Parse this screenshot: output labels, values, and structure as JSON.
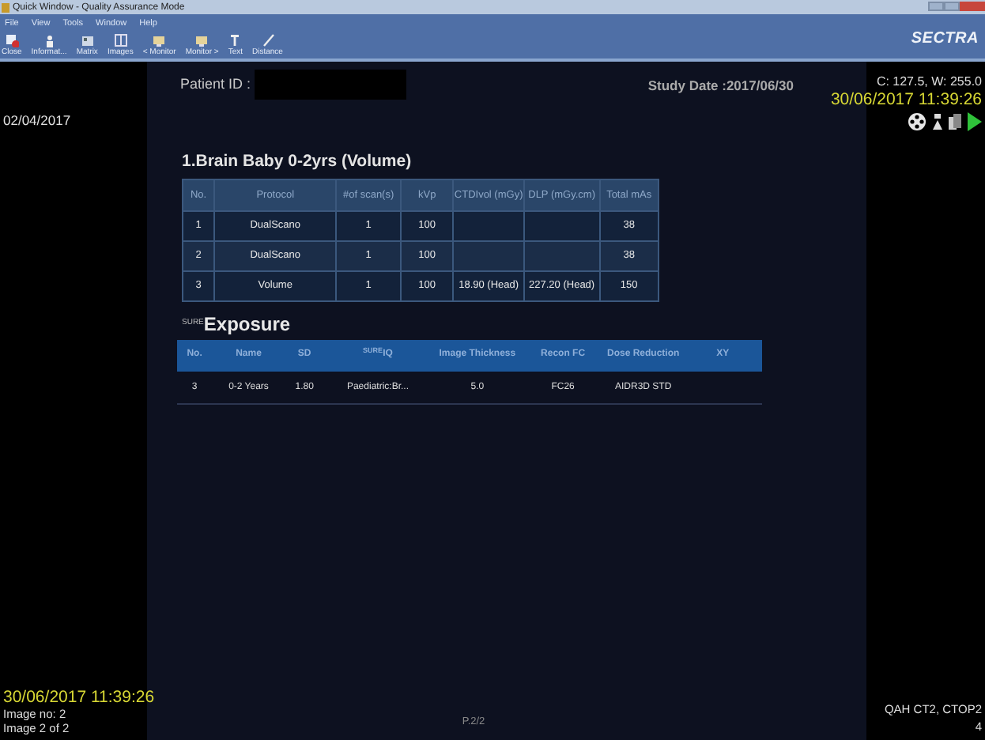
{
  "window": {
    "title": "Quick Window - Quality Assurance Mode"
  },
  "menu": [
    "File",
    "View",
    "Tools",
    "Window",
    "Help"
  ],
  "toolbar": [
    {
      "label": "Close",
      "kind": "close"
    },
    {
      "label": "Informat...",
      "kind": "info"
    },
    {
      "label": "Matrix",
      "kind": "matrix"
    },
    {
      "label": "Images",
      "kind": "images"
    },
    {
      "label": "< Monitor",
      "kind": "monitor"
    },
    {
      "label": "Monitor >",
      "kind": "monitor"
    },
    {
      "label": "Text",
      "kind": "text"
    },
    {
      "label": "Distance",
      "kind": "distance"
    }
  ],
  "brand": "SECTRA",
  "left_date": "02/04/2017",
  "patient_id_label": "Patient ID :",
  "study_date": "Study Date :2017/06/30",
  "window_level": "C: 127.5, W: 255.0",
  "top_timestamp": "30/06/2017 11:39:26",
  "section_title": "1.Brain Baby 0-2yrs  (Volume)",
  "scan_table": {
    "columns": [
      "No.",
      "Protocol",
      "#of scan(s)",
      "kVp",
      "CTDIvol (mGy)",
      "DLP (mGy.cm)",
      "Total mAs"
    ],
    "rows": [
      [
        "1",
        "DualScano",
        "1",
        "100",
        "",
        "",
        "38"
      ],
      [
        "2",
        "DualScano",
        "1",
        "100",
        "",
        "",
        "38"
      ],
      [
        "3",
        "Volume",
        "1",
        "100",
        "18.90 (Head)",
        "227.20 (Head)",
        "150"
      ]
    ]
  },
  "exposure_title": {
    "prefix": "SURE",
    "text": "Exposure"
  },
  "exposure_table": {
    "columns": [
      "No.",
      "Name",
      "SD",
      "$^{SURE}$IQ",
      "Image Thickness",
      "Recon FC",
      "Dose Reduction",
      "XY"
    ],
    "rows": [
      [
        "3",
        "0-2 Years",
        "1.80",
        "Paediatric:Br...",
        "5.0",
        "FC26",
        "AIDR3D STD",
        ""
      ]
    ]
  },
  "bottom_timestamp": "30/06/2017 11:39:26",
  "image_no": "Image no: 2",
  "image_of": "Image 2 of 2",
  "page": "P.2/2",
  "station": "QAH CT2, CTOP2",
  "station_number": "4"
}
